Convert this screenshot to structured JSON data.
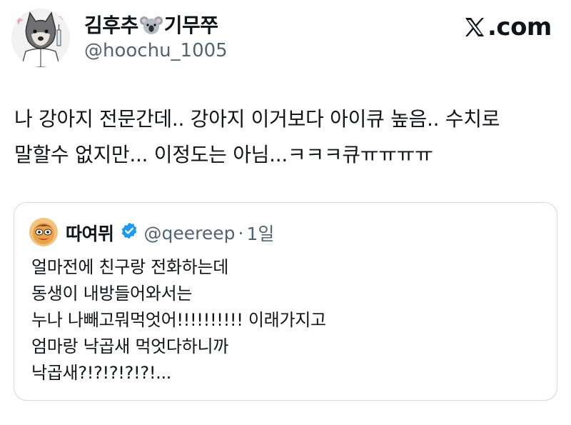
{
  "author": {
    "display_name_left": "김후추",
    "display_name_right": "기무쭈",
    "display_name_emoji": "koala-emoji",
    "handle": "@hoochu_1005",
    "avatar_icon": "wolf-doctor-avatar"
  },
  "brand": {
    "label": ".com",
    "icon": "x-logo-icon"
  },
  "tweet": {
    "lines": [
      "나 강아지 전문간데.. 강아지 이거보다 아이큐 높음.. 수치로",
      "말할수 없지만... 이정도는 아님...ㅋㅋㅋ큐ㅠㅠㅠㅠ"
    ]
  },
  "quoted": {
    "display_name": "따여뮈",
    "handle": "@qeereep",
    "separator": "·",
    "time": "1일",
    "verified_color": "#1d9bf0",
    "avatar_icon": "cartoon-face-avatar",
    "lines": [
      "얼마전에 친구랑 전화하는데",
      "동생이 내방들어와서는",
      "누나 나빼고뭐먹엇어!!!!!!!!!! 이래가지고",
      "엄마랑 낙곱새 먹엇다하니까",
      "낙곱새?!?!?!?!?!..."
    ]
  },
  "colors": {
    "text": "#0f1419",
    "secondary_text": "#536471",
    "border": "#cfd9de",
    "verified": "#1d9bf0"
  }
}
